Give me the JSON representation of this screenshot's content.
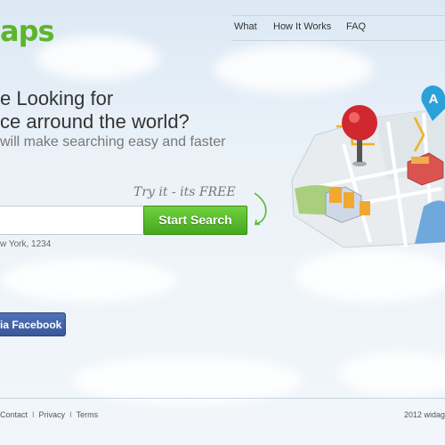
{
  "brand": {
    "logo_text": "aps",
    "accent": "#5db52b"
  },
  "nav": {
    "items": [
      "What",
      "How It Works",
      "FAQ"
    ]
  },
  "hero": {
    "line1": "e Looking for",
    "line2": "ce arround the world?",
    "subline": "will make searching easy and faster",
    "tryit": "Try it - its FREE"
  },
  "search": {
    "value": "",
    "button_label": "Start Search",
    "hint": "w York, 1234",
    "button_color": "#45a81c"
  },
  "facebook": {
    "label": "ia Facebook",
    "color": "#3b5998"
  },
  "footer": {
    "links": [
      "Contact",
      "Privacy",
      "Terms"
    ],
    "copyright": "2012 widag"
  },
  "illustration": {
    "icon": "map-pin-illustration",
    "marker_letter": "A"
  }
}
